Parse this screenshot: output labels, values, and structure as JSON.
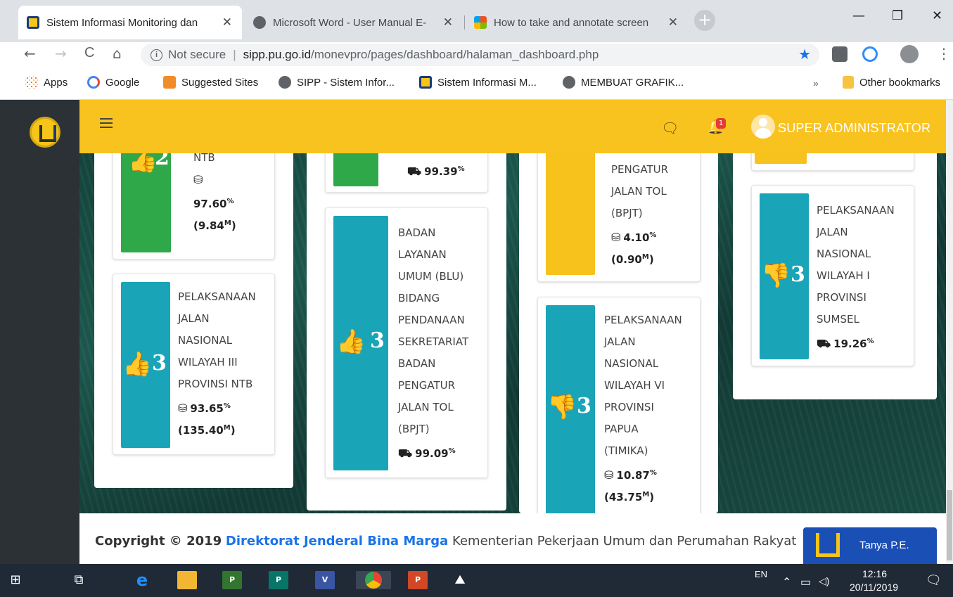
{
  "browser": {
    "tabs": [
      {
        "title": "Sistem Informasi Monitoring dan",
        "active": true,
        "favicon": "pupr-logo"
      },
      {
        "title": "Microsoft Word - User Manual E-",
        "active": false,
        "favicon": "globe-icon"
      },
      {
        "title": "How to take and annotate screen",
        "active": false,
        "favicon": "windows-logo"
      }
    ],
    "tab_close": "✕",
    "new_tab": "+",
    "window_controls": {
      "minimize": "—",
      "restore": "❐",
      "close": "✕"
    },
    "nav": {
      "back": "←",
      "forward": "→",
      "reload": "C",
      "home": "⌂"
    },
    "address": {
      "security": "Not secure",
      "host": "sipp.pu.go.id",
      "path": "/monevpro/pages/dashboard/halaman_dashboard.php"
    },
    "bookmarks": [
      {
        "label": "Apps",
        "icon": "apps-grid-icon"
      },
      {
        "label": "Google",
        "icon": "google-icon"
      },
      {
        "label": "Suggested Sites",
        "icon": "suggested-sites-icon"
      },
      {
        "label": "SIPP - Sistem Infor...",
        "icon": "globe-icon"
      },
      {
        "label": "Sistem Informasi M...",
        "icon": "pupr-logo"
      },
      {
        "label": "MEMBUAT GRAFIK...",
        "icon": "globe-icon"
      }
    ],
    "bookmarks_more": "»",
    "other_bookmarks": "Other bookmarks"
  },
  "app": {
    "username": "SUPER ADMINISTRATOR",
    "notification_count": "1",
    "colors": {
      "header": "#f9c31f",
      "sidebar": "#2c3136",
      "green": "#2fa84a",
      "teal": "#1aa4b8",
      "yellow": "#f7c21b"
    }
  },
  "cards": [
    {
      "id": "c1",
      "color": "green",
      "thumb": "up",
      "rank": "2",
      "lines": [
        "NTB"
      ],
      "stat_icon": "coins-icon",
      "stat_pct": "97.60",
      "stat_m": "9.84"
    },
    {
      "id": "c2",
      "color": "teal",
      "thumb": "up",
      "rank": "3",
      "lines": [
        "PELAKSANAAN",
        "JALAN",
        "NASIONAL",
        "WILAYAH III",
        "PROVINSI NTB"
      ],
      "stat_icon": "coins-icon",
      "stat_pct": "93.65",
      "stat_m": "135.40"
    },
    {
      "id": "c3",
      "color": "green",
      "thumb": "",
      "rank": "",
      "lines": [],
      "stat_icon": "bulldozer-icon",
      "stat_pct": "99.39",
      "stat_m": ""
    },
    {
      "id": "c4",
      "color": "teal",
      "thumb": "up",
      "rank": "3",
      "lines": [
        "BADAN",
        "LAYANAN",
        "UMUM (BLU)",
        "BIDANG",
        "PENDANAAN",
        "SEKRETARIAT",
        "BADAN",
        "PENGATUR",
        "JALAN TOL",
        "(BPJT)"
      ],
      "stat_icon": "bulldozer-icon",
      "stat_pct": "99.09",
      "stat_m": ""
    },
    {
      "id": "c5",
      "color": "yellow",
      "thumb": "",
      "rank": "",
      "lines": [
        "PENGATUR",
        "JALAN TOL",
        "(BPJT)"
      ],
      "stat_icon": "coins-icon",
      "stat_pct": "4.10",
      "stat_m": "0.90"
    },
    {
      "id": "c6",
      "color": "teal",
      "thumb": "down",
      "rank": "3",
      "lines": [
        "PELAKSANAAN",
        "JALAN",
        "NASIONAL",
        "WILAYAH VI",
        "PROVINSI",
        "PAPUA",
        "(TIMIKA)"
      ],
      "stat_icon": "coins-icon",
      "stat_pct": "10.87",
      "stat_m": "43.75"
    },
    {
      "id": "c7",
      "color": "teal",
      "thumb": "down",
      "rank": "3",
      "lines": [
        "PELAKSANAAN",
        "JALAN",
        "NASIONAL",
        "WILAYAH I",
        "PROVINSI",
        "SUMSEL"
      ],
      "stat_icon": "bulldozer-icon",
      "stat_pct": "19.26",
      "stat_m": ""
    }
  ],
  "units": {
    "percent": "%",
    "million": "M"
  },
  "footer": {
    "copyright_prefix": "Copyright © 2019",
    "org": "Direktorat Jenderal Bina Marga",
    "ministry": "Kementerian Pekerjaan Umum dan Perumahan Rakyat",
    "help_button": "Tanya P.E."
  },
  "taskbar": {
    "language": "EN",
    "time": "12:16",
    "date": "20/11/2019",
    "apps": [
      "windows-start-icon",
      "task-view-icon",
      "edge-icon",
      "file-explorer-icon",
      "project-icon",
      "publisher-icon",
      "visio-icon",
      "chrome-icon",
      "powerpoint-icon",
      "photos-icon"
    ]
  }
}
